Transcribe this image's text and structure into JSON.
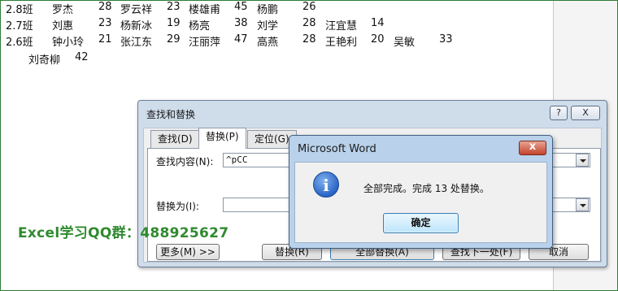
{
  "document": {
    "rows": [
      {
        "cells": [
          "2.8班",
          "罗杰",
          "28",
          "罗云祥",
          "23",
          "楼雄甫",
          "45",
          "杨鹏",
          "26"
        ]
      },
      {
        "cells": [
          "2.7班",
          "刘惠",
          "23",
          "杨新冰",
          "19",
          "杨亮",
          "38",
          "刘学",
          "28",
          "汪宜慧",
          "14"
        ]
      },
      {
        "cells": [
          "2.6班",
          "钟小玲",
          "21",
          "张江东",
          "29",
          "汪丽萍",
          "47",
          "高燕",
          "28",
          "王艳利",
          "20",
          "吴敏",
          "33"
        ]
      },
      {
        "cells": [
          "刘奇柳",
          "42"
        ]
      }
    ]
  },
  "watermark": "Excel学习QQ群：488925627",
  "find_replace_dialog": {
    "title": "查找和替换",
    "help_label": "?",
    "close_label": "X",
    "tabs": [
      {
        "label": "查找(D)"
      },
      {
        "label": "替换(P)"
      },
      {
        "label": "定位(G)"
      }
    ],
    "find_label": "查找内容(N):",
    "find_value": "^pCC",
    "replace_label": "替换为(I):",
    "replace_value": "",
    "buttons": {
      "more": "更多(M) >>",
      "replace": "替换(R)",
      "replace_all": "全部替换(A)",
      "find_next": "查找下一处(F)",
      "cancel": "取消"
    }
  },
  "message_box": {
    "title": "Microsoft Word",
    "close_label": "x",
    "icon": "info-icon",
    "icon_glyph": "i",
    "message": "全部完成。完成 13 处替换。",
    "ok_label": "确定"
  }
}
